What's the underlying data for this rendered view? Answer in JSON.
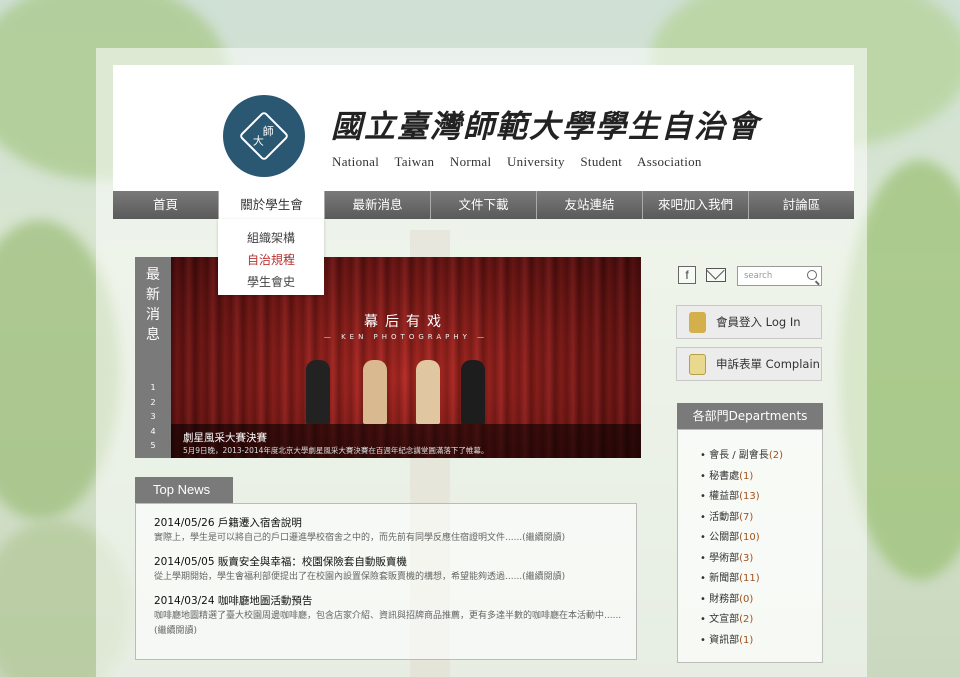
{
  "header": {
    "title_zh": "國立臺灣師範大學學生自治會",
    "title_en": "National Taiwan Normal University Student Association",
    "logo_text_line1": "師",
    "logo_text_line2": "大"
  },
  "nav": {
    "items": [
      "首頁",
      "關於學生會",
      "最新消息",
      "文件下載",
      "友站連結",
      "來吧加入我們",
      "討論區"
    ],
    "active_index": 1
  },
  "dropdown": {
    "items": [
      "組織架構",
      "自治規程",
      "學生會史"
    ],
    "hover_index": 1
  },
  "slider": {
    "side_title": [
      "最",
      "新",
      "消",
      "息"
    ],
    "pages": [
      "1",
      "2",
      "3",
      "4",
      "5"
    ],
    "image_title": "幕后有戏",
    "image_subtitle": "— KEN PHOTOGRAPHY —",
    "caption_title": "劇星風采大賽決賽",
    "caption_text": "5月9日晚，2013-2014年度北京大學劇星風采大賽決賽在百週年紀念講堂圓滿落下了帷幕。"
  },
  "top_news": {
    "tab_label": "Top News",
    "items": [
      {
        "headline": "2014/05/26 戶籍遷入宿舍說明",
        "body": "實際上，學生是可以將自己的戶口遷進學校宿舍之中的，而先前有同學反應住宿證明文件......(繼續閱讀)"
      },
      {
        "headline": "2014/05/05 販賣安全與幸福：校園保險套自動販賣機",
        "body": "從上學期開始，學生會福利部便提出了在校園內設置保險套販賣機的構想，希望能夠透過......(繼續閱讀)"
      },
      {
        "headline": "2014/03/24 咖啡廳地圖活動預告",
        "body": "咖啡廳地圖精選了臺大校園周邊咖啡廳，包含店家介紹、資訊與招牌商品推薦，更有多達半數的咖啡廳在本活動中......(繼續閱讀)"
      }
    ]
  },
  "sidebar": {
    "facebook_glyph": "f",
    "search_placeholder": "search",
    "login_label": "會員登入  Log In",
    "complain_label": "申訴表單  Complain",
    "departments_title": "各部門Departments",
    "departments": [
      {
        "name": "會長 / 副會長",
        "count": "(2)"
      },
      {
        "name": "秘書處",
        "count": "(1)"
      },
      {
        "name": "權益部",
        "count": "(13)"
      },
      {
        "name": "活動部",
        "count": "(7)"
      },
      {
        "name": "公關部",
        "count": "(10)"
      },
      {
        "name": "學術部",
        "count": "(3)"
      },
      {
        "name": "新聞部",
        "count": "(11)"
      },
      {
        "name": "財務部",
        "count": "(0)"
      },
      {
        "name": "文宣部",
        "count": "(2)"
      },
      {
        "name": "資訊部",
        "count": "(1)"
      }
    ]
  },
  "colors": {
    "nav_bg": "#6a6a6a",
    "logo_blue": "#2a5772",
    "count_orange": "#a0521d",
    "hover_red": "#b33333"
  }
}
